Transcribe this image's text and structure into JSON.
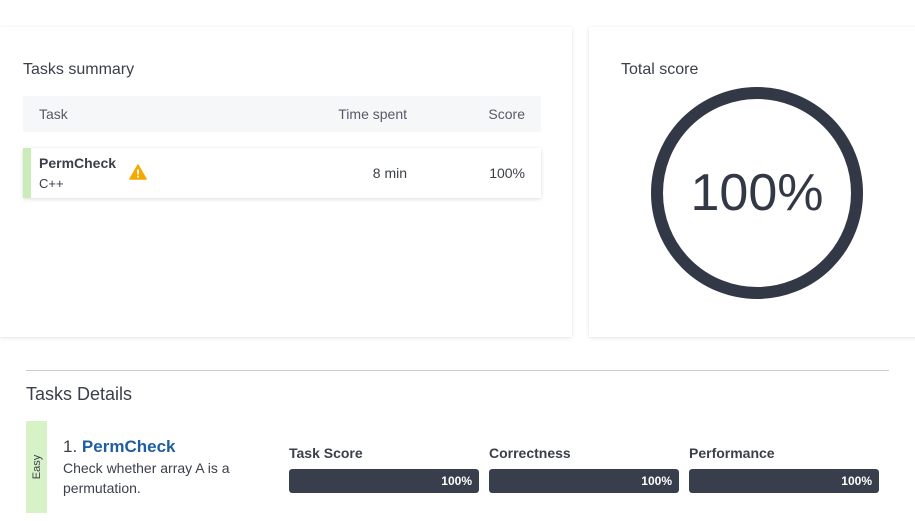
{
  "summary": {
    "title": "Tasks summary",
    "columns": {
      "task": "Task",
      "time": "Time spent",
      "score": "Score"
    },
    "rows": [
      {
        "name": "PermCheck",
        "language": "C++",
        "time_spent": "8 min",
        "score": "100%",
        "warning_icon": "warning-triangle-icon"
      }
    ]
  },
  "total": {
    "title": "Total score",
    "score": "100%",
    "fraction": 1.0
  },
  "details": {
    "title": "Tasks Details",
    "task": {
      "difficulty": "Easy",
      "number": "1.",
      "name": "PermCheck",
      "description": "Check whether array A is a permutation."
    },
    "metrics": [
      {
        "label": "Task Score",
        "value": "100%",
        "fraction": 1.0
      },
      {
        "label": "Correctness",
        "value": "100%",
        "fraction": 1.0
      },
      {
        "label": "Performance",
        "value": "100%",
        "fraction": 1.0
      }
    ]
  },
  "colors": {
    "accent_green": "#c9ecb8",
    "easy_green": "#d6f2c6",
    "ring": "#333846",
    "bar": "#393e4d",
    "link": "#1f5fa1",
    "warning": "#f5a800"
  }
}
